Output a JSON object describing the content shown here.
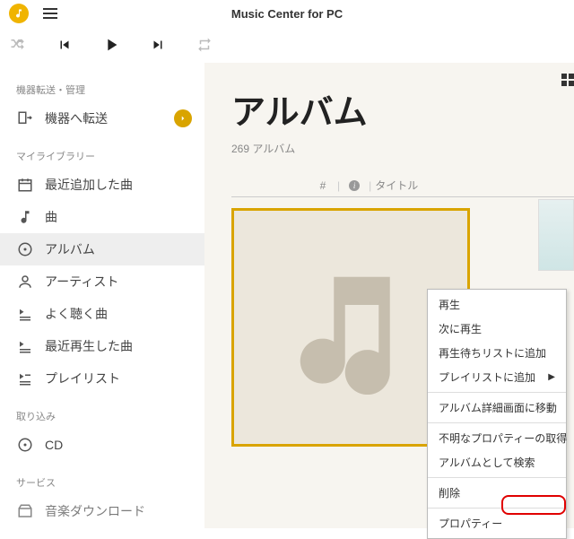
{
  "app": {
    "title": "Music Center for PC"
  },
  "sidebar": {
    "section_device": "機器転送・管理",
    "item_transfer": "機器へ転送",
    "section_library": "マイライブラリー",
    "item_recent_added": "最近追加した曲",
    "item_songs": "曲",
    "item_albums": "アルバム",
    "item_artists": "アーティスト",
    "item_often": "よく聴く曲",
    "item_recent_played": "最近再生した曲",
    "item_playlists": "プレイリスト",
    "section_import": "取り込み",
    "item_cd": "CD",
    "section_service": "サービス",
    "item_download": "音楽ダウンロード"
  },
  "content": {
    "title": "アルバム",
    "subtitle": "269 アルバム",
    "col_num": "#",
    "col_title": "タイトル"
  },
  "context_menu": {
    "play": "再生",
    "play_next": "次に再生",
    "add_queue": "再生待ちリストに追加",
    "add_playlist": "プレイリストに追加",
    "goto_detail": "アルバム詳細画面に移動",
    "get_unknown_props": "不明なプロパティーの取得",
    "search_as_album": "アルバムとして検索",
    "delete": "削除",
    "properties": "プロパティー"
  }
}
